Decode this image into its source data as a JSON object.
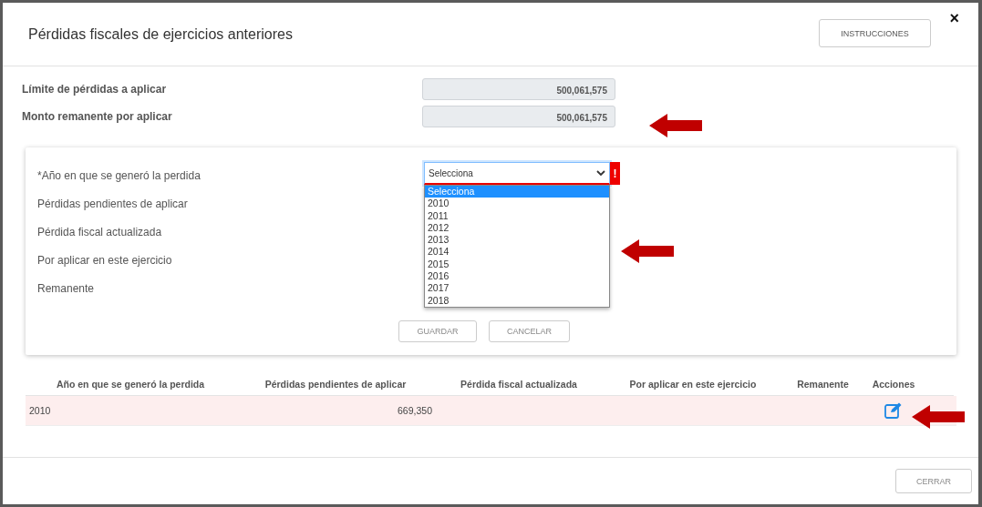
{
  "dialog": {
    "title": "Pérdidas fiscales de ejercicios anteriores",
    "instructions_button": "INSTRUCCIONES",
    "close": "×"
  },
  "summary": [
    {
      "label": "Límite de pérdidas a aplicar",
      "value": "500,061,575"
    },
    {
      "label": "Monto remanente por aplicar",
      "value": "500,061,575"
    }
  ],
  "form": {
    "year_select": {
      "label": "*Año en que se generó la perdida",
      "value": "Selecciona",
      "error": true,
      "error_mark": "!",
      "expanded": true
    },
    "labels": [
      "Pérdidas pendientes de aplicar",
      "Pérdida fiscal actualizada",
      "Por aplicar en este ejercicio",
      "Remanente"
    ],
    "options": [
      {
        "label": "Selecciona",
        "selected": true
      },
      {
        "label": "2010",
        "selected": false
      },
      {
        "label": "2011",
        "selected": false
      },
      {
        "label": "2012",
        "selected": false
      },
      {
        "label": "2013",
        "selected": false
      },
      {
        "label": "2014",
        "selected": false
      },
      {
        "label": "2015",
        "selected": false
      },
      {
        "label": "2016",
        "selected": false
      },
      {
        "label": "2017",
        "selected": false
      },
      {
        "label": "2018",
        "selected": false
      }
    ],
    "buttons": [
      "GUARDAR",
      "CANCELAR"
    ]
  },
  "table": {
    "columns": [
      "Año en que se generó la perdida",
      "Pérdidas pendientes de aplicar",
      "Pérdida fiscal actualizada",
      "Por aplicar en este ejercicio",
      "Remanente",
      "Acciones"
    ],
    "rows": [
      {
        "year": "2010",
        "pending_loss": "669,350",
        "highlighted": true
      }
    ]
  },
  "footer": {
    "close_button": "CERRAR"
  }
}
